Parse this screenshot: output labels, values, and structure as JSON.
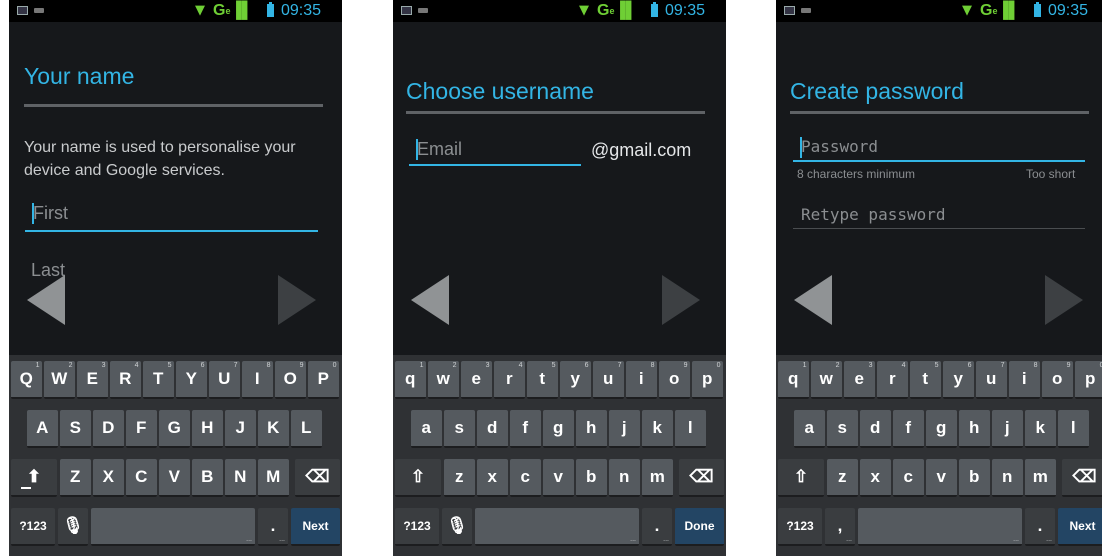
{
  "status_bar": {
    "network": "G",
    "network_sup": "e",
    "bars": "▐▌",
    "time": "09:35"
  },
  "screens": {
    "name": {
      "title": "Your name",
      "description": "Your name is used to personalise your device and Google services.",
      "first_placeholder": "First",
      "last_placeholder": "Last"
    },
    "username": {
      "title": "Choose username",
      "email_placeholder": "Email",
      "domain_suffix": "@gmail.com"
    },
    "password": {
      "title": "Create password",
      "password_placeholder": "Password",
      "hint_min": "8 characters minimum",
      "hint_strength": "Too short",
      "retype_placeholder": "Retype password"
    }
  },
  "keyboard": {
    "digits": [
      "1",
      "2",
      "3",
      "4",
      "5",
      "6",
      "7",
      "8",
      "9",
      "0"
    ],
    "upper_rows": [
      [
        "Q",
        "W",
        "E",
        "R",
        "T",
        "Y",
        "U",
        "I",
        "O",
        "P"
      ],
      [
        "A",
        "S",
        "D",
        "F",
        "G",
        "H",
        "J",
        "K",
        "L"
      ],
      [
        "Z",
        "X",
        "C",
        "V",
        "B",
        "N",
        "M"
      ]
    ],
    "lower_rows": [
      [
        "q",
        "w",
        "e",
        "r",
        "t",
        "y",
        "u",
        "i",
        "o",
        "p"
      ],
      [
        "a",
        "s",
        "d",
        "f",
        "g",
        "h",
        "j",
        "k",
        "l"
      ],
      [
        "z",
        "x",
        "c",
        "v",
        "b",
        "n",
        "m"
      ]
    ],
    "symbols_label": "?123",
    "comma_label": ",",
    "period_label": ".",
    "dots_label": "...",
    "mic_glyph": "🎙",
    "shift_glyph": "⬆",
    "shift_outline_glyph": "⇧",
    "delete_glyph": "⌫",
    "next_label": "Next",
    "done_label": "Done"
  },
  "colors": {
    "accent": "#33b5e5",
    "signal": "#6fcf35",
    "action_key": "#234564"
  }
}
